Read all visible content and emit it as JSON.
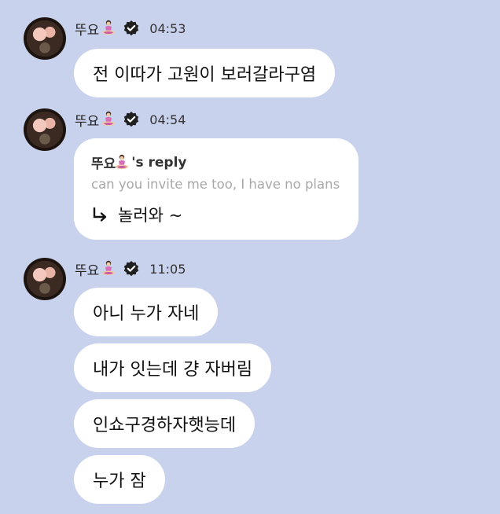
{
  "messages": [
    {
      "sender": "뚜요",
      "time": "04:53",
      "bubbles": [
        "전 이따가 고원이 보러갈라구염"
      ]
    },
    {
      "sender": "뚜요",
      "time": "04:54",
      "reply": {
        "from": "뚜요",
        "suffix": "'s reply",
        "quote": "can you invite me too, I have no plans",
        "text": "놀러와 ~"
      }
    },
    {
      "sender": "뚜요",
      "time": "11:05",
      "bubbles": [
        "아니 누가 자네",
        "내가 잇는데 걍 자버림",
        "인쇼구경하자햇능데",
        "누가 잠"
      ]
    }
  ],
  "icons": {
    "emoji": "person-in-lotus-position-emoji",
    "verified": "verified-check-icon",
    "reply_arrow": "reply-arrow-icon"
  },
  "colors": {
    "background": "#c9d2ed",
    "bubble": "#ffffff",
    "verified_badge": "#1f1f1f"
  }
}
